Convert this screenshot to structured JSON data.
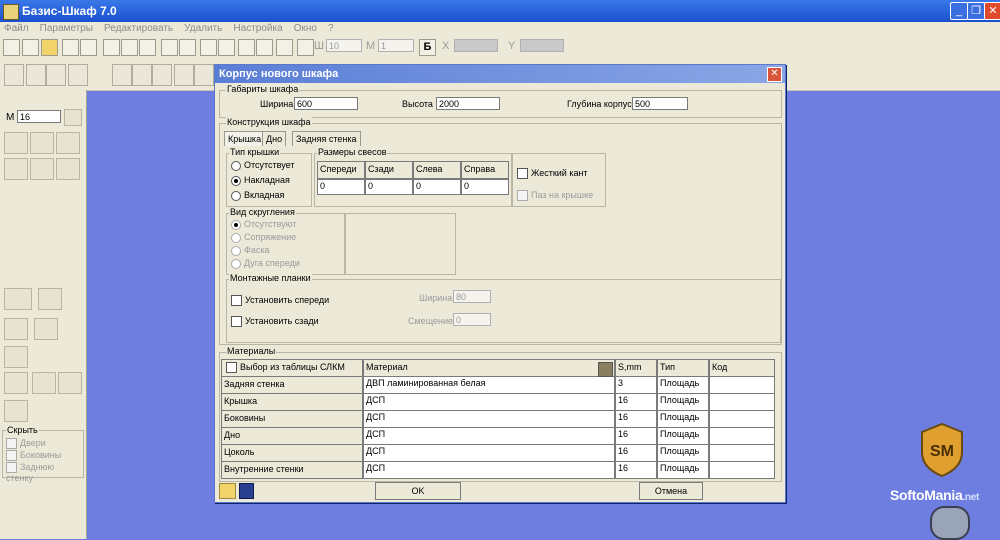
{
  "window": {
    "title": "Базис-Шкаф 7.0"
  },
  "menu": [
    "Файл",
    "Параметры",
    "Редактировать",
    "Удалить",
    "Настройка",
    "Окно",
    "?"
  ],
  "toolbar": {
    "w_value": "10",
    "m_label": "М",
    "m_value": "1",
    "x_label": "X",
    "y_label": "Y"
  },
  "leftpanel": {
    "m_label": "М",
    "m_value": "16",
    "hide_title": "Скрыть",
    "hide_items": [
      "Двери",
      "Боковины",
      "Заднюю стенку"
    ]
  },
  "dialog": {
    "title": "Корпус нового шкафа",
    "dims": {
      "legend": "Габариты шкафа",
      "width_label": "Ширина",
      "width_value": "600",
      "height_label": "Высота",
      "height_value": "2000",
      "depth_label": "Глубина корпуса",
      "depth_value": "500"
    },
    "construction": {
      "legend": "Конструкция шкафа",
      "tabs": [
        "Крышка",
        "Дно",
        "Задняя стенка"
      ],
      "cover_type": {
        "legend": "Тип крышки",
        "options": [
          "Отсутствует",
          "Накладная",
          "Вкладная"
        ],
        "selected": "Накладная"
      },
      "overhang": {
        "legend": "Размеры свесов",
        "headers": [
          "Спереди",
          "Сзади",
          "Слева",
          "Справа"
        ],
        "values": [
          "0",
          "0",
          "0",
          "0"
        ]
      },
      "rigid_edge": "Жесткий кант",
      "groove": "Паз на крышке",
      "rounding": {
        "legend": "Вид скругления",
        "options": [
          "Отсутствуют",
          "Сопряжение",
          "Фаска",
          "Дуга спереди"
        ]
      },
      "mounting": {
        "legend": "Монтажные планки",
        "front": "Установить спереди",
        "back": "Установить сзади",
        "width_label": "Ширина",
        "width_value": "80",
        "offset_label": "Смещение",
        "offset_value": "0"
      }
    },
    "materials": {
      "legend": "Материалы",
      "from_table": "Выбор из таблицы СЛКМ",
      "headers": [
        "Материал",
        "S,mm",
        "Тип",
        "Код"
      ],
      "rows": [
        {
          "part": "Задняя стенка",
          "material": "ДВП ламинированная белая",
          "s": "3",
          "type": "Площадь",
          "code": ""
        },
        {
          "part": "Крышка",
          "material": "ДСП",
          "s": "16",
          "type": "Площадь",
          "code": ""
        },
        {
          "part": "Боковины",
          "material": "ДСП",
          "s": "16",
          "type": "Площадь",
          "code": ""
        },
        {
          "part": "Дно",
          "material": "ДСП",
          "s": "16",
          "type": "Площадь",
          "code": ""
        },
        {
          "part": "Цоколь",
          "material": "ДСП",
          "s": "16",
          "type": "Площадь",
          "code": ""
        },
        {
          "part": "Внутренние стенки",
          "material": "ДСП",
          "s": "16",
          "type": "Площадь",
          "code": ""
        }
      ]
    },
    "ok": "OK",
    "cancel": "Отмена"
  },
  "watermark": {
    "text": "SoftoMania",
    "domain": ".net",
    "logo": "SM"
  }
}
